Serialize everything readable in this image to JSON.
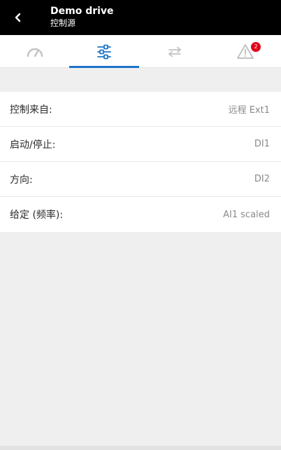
{
  "header": {
    "title": "Demo drive",
    "subtitle": "控制源"
  },
  "tabs": [
    {
      "icon": "gauge-icon",
      "active": false
    },
    {
      "icon": "sliders-icon",
      "active": true
    },
    {
      "icon": "transfer-arrows-icon",
      "active": false
    },
    {
      "icon": "warning-icon",
      "active": false,
      "badge": "2"
    }
  ],
  "rows": [
    {
      "label": "控制来自:",
      "value": "远程 Ext1"
    },
    {
      "label": "启动/停止:",
      "value": "DI1"
    },
    {
      "label": "方向:",
      "value": "DI2"
    },
    {
      "label": "给定 (频率):",
      "value": "AI1 scaled"
    }
  ],
  "colors": {
    "header_bg": "#000000",
    "accent": "#1f73c8",
    "badge": "#e2001a",
    "background": "#efefef"
  }
}
